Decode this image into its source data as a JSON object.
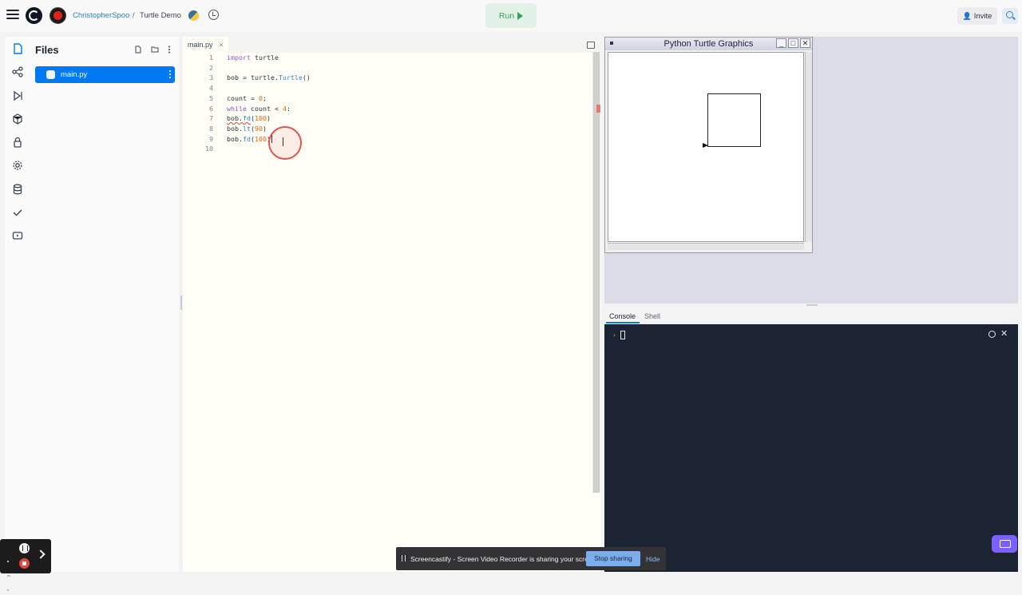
{
  "topbar": {
    "user": "ChristopherSpoo",
    "separator": "/",
    "project": "Turtle Demo",
    "run_label": "Run",
    "invite_label": "Invite",
    "accent": "#0079f2",
    "run_color": "#37a657"
  },
  "sidebar": {
    "icons": [
      "files-icon",
      "share-icon",
      "debugger-icon",
      "packages-icon",
      "secrets-icon",
      "settings-icon",
      "database-icon",
      "unit-tests-icon",
      "video-icon"
    ]
  },
  "files": {
    "title": "Files",
    "items": [
      {
        "name": "main.py",
        "selected": true
      }
    ]
  },
  "editor": {
    "tab_label": "main.py",
    "tab_close": "×",
    "lines": [
      {
        "n": "1",
        "text": "import turtle"
      },
      {
        "n": "2",
        "text": ""
      },
      {
        "n": "3",
        "text": "bob = turtle.Turtle()"
      },
      {
        "n": "4",
        "text": ""
      },
      {
        "n": "5",
        "text": "count = 0;"
      },
      {
        "n": "6",
        "text": "while count < 4:"
      },
      {
        "n": "7",
        "text": "bob.fd(100)"
      },
      {
        "n": "8",
        "text": "bob.lt(90)"
      },
      {
        "n": "9",
        "text": "bob.fd(100)"
      },
      {
        "n": "10",
        "text": ""
      }
    ]
  },
  "turtle_window": {
    "title": "Python Turtle Graphics",
    "minimize": "_",
    "maximize": "□",
    "close": "✕"
  },
  "console": {
    "tabs": [
      "Console",
      "Shell"
    ],
    "active_tab": "Console",
    "prompt": "›",
    "close": "✕"
  },
  "share_bar": {
    "text": "Screencastify - Screen Video Recorder is sharing your screen.",
    "stop_label": "Stop sharing",
    "hide_label": "Hide"
  }
}
